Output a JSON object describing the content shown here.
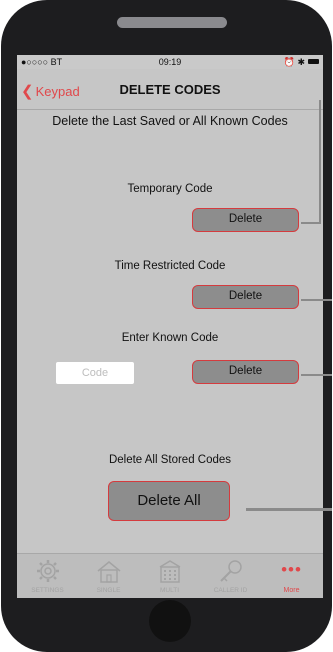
{
  "status_bar": {
    "carrier": "●○○○○ BT",
    "time": "09:19",
    "right": "⏰ ✱"
  },
  "nav": {
    "back_label": "Keypad",
    "title": "DELETE CODES"
  },
  "intro": "Delete the Last Saved or All Known Codes",
  "sections": {
    "temporary": {
      "label": "Temporary Code",
      "button": "Delete"
    },
    "time_restricted": {
      "label": "Time Restricted Code",
      "button": "Delete"
    },
    "known": {
      "label": "Enter Known Code",
      "placeholder": "Code",
      "button": "Delete"
    },
    "all": {
      "label": "Delete All Stored Codes",
      "button": "Delete All"
    }
  },
  "tabs": [
    {
      "label": "SETTINGS",
      "icon": "gear-icon",
      "active": false
    },
    {
      "label": "SINGLE",
      "icon": "house-icon",
      "active": false
    },
    {
      "label": "MULTI",
      "icon": "building-icon",
      "active": false
    },
    {
      "label": "CALLER ID",
      "icon": "key-icon",
      "active": false
    },
    {
      "label": "More",
      "icon": "more-dots-icon",
      "active": true
    }
  ],
  "colors": {
    "accent": "#e0484b",
    "screen_bg": "#c6c6c6",
    "button_bg": "#8d8d8d"
  }
}
